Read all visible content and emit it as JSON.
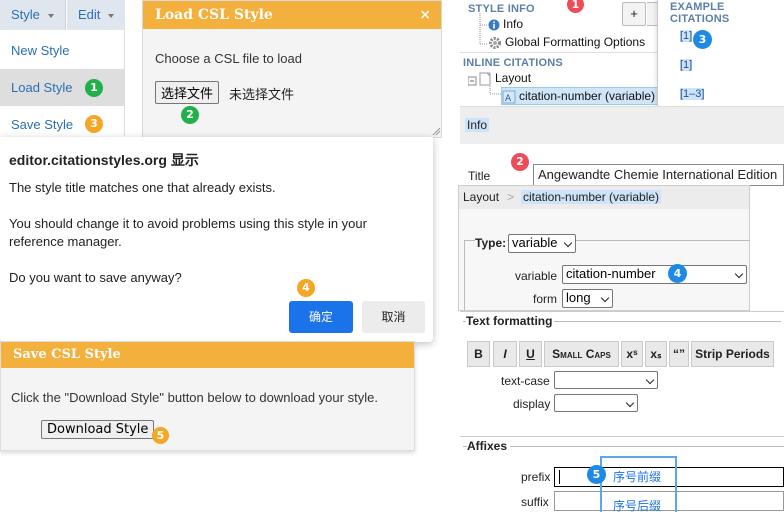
{
  "left_menu": {
    "style_label": "Style",
    "edit_label": "Edit",
    "items": [
      {
        "label": "New Style",
        "badge": ""
      },
      {
        "label": "Load Style",
        "badge": "1"
      },
      {
        "label": "Save Style",
        "badge": "3"
      }
    ]
  },
  "load_dialog": {
    "title": "Load CSL Style",
    "close": "×",
    "prompt": "Choose a CSL file to load",
    "choose_button": "选择文件",
    "no_file": "未选择文件",
    "badge": "2"
  },
  "alert": {
    "host": "editor.citationstyles.org 显示",
    "line1": "The style title matches one that already exists.",
    "line2": "You should change it to avoid problems using this style in your",
    "line3": "reference manager.",
    "line4": "Do you want to save anyway?",
    "ok": "确定",
    "cancel": "取消",
    "badge": "4"
  },
  "save_dialog": {
    "title": "Save CSL Style",
    "text": "Click the \"Download Style\" button below to download your style.",
    "download_button": "Download Style",
    "badge": "5"
  },
  "tree": {
    "style_info": "STYLE INFO",
    "style_info_badge": "1",
    "info": "Info",
    "global": "Global Formatting Options",
    "inline": "INLINE CITATIONS",
    "layout": "Layout",
    "variable": "citation-number (variable)",
    "add": "+"
  },
  "examples": {
    "header": "EXAMPLE CITATIONS",
    "items": [
      "[1]",
      "[1]",
      "[1–3]"
    ],
    "badge": "3"
  },
  "infobar": {
    "label": "Info"
  },
  "title_row": {
    "label": "Title",
    "value": "Angewandte Chemie International Edition",
    "badge": "2"
  },
  "layout_panel": {
    "crumb1": "Layout",
    "sep": ">",
    "crumb2": "citation-number (variable)",
    "type_label": "Type:",
    "type_value": "variable",
    "variable_label": "variable",
    "variable_value": "citation-number",
    "variable_badge": "4",
    "form_label": "form",
    "form_value": "long"
  },
  "text_formatting": {
    "legend": "Text formatting",
    "buttons": [
      "B",
      "I",
      "U",
      "Small Caps",
      "xˢ",
      "xₛ",
      "“”",
      "Strip Periods"
    ],
    "text_case_label": "text-case",
    "display_label": "display"
  },
  "affixes": {
    "legend": "Affixes",
    "prefix_label": "prefix",
    "suffix_label": "suffix",
    "prefix_annot": "序号前缀",
    "suffix_annot": "序号后缀",
    "badge": "5"
  }
}
